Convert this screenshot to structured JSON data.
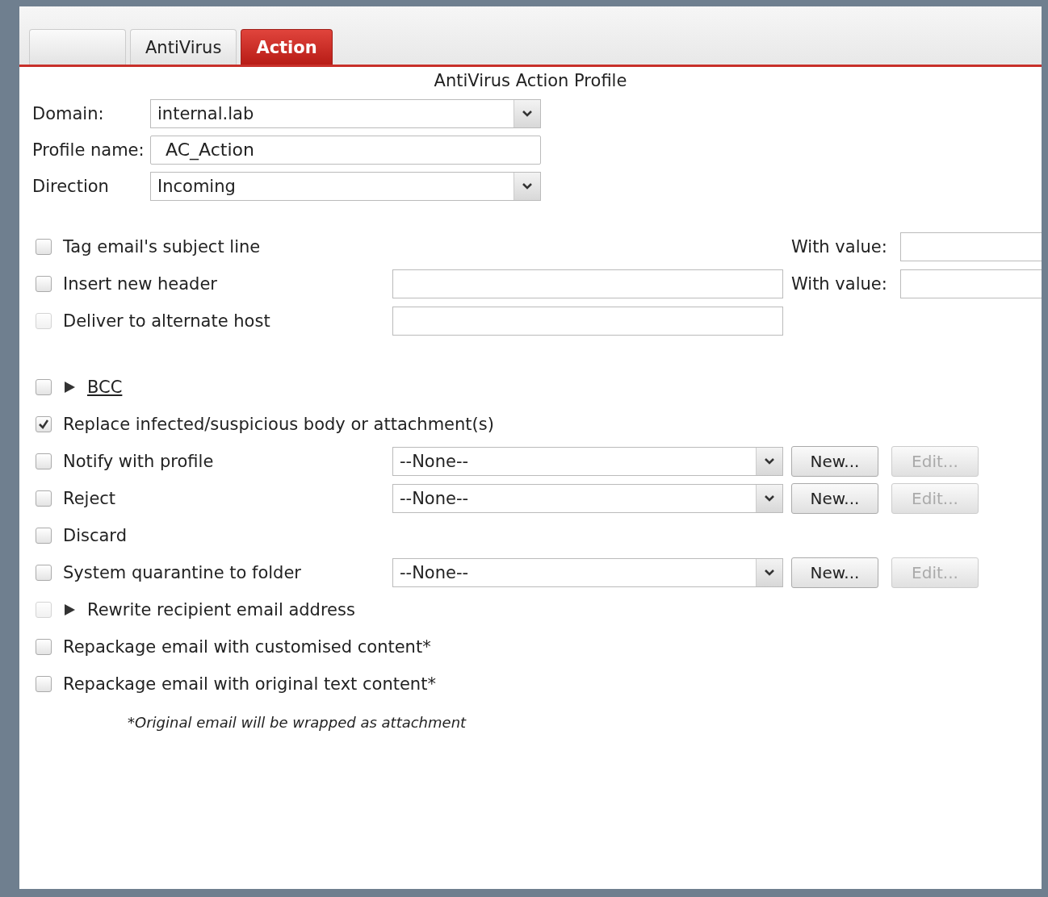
{
  "tabs": [
    {
      "selected": false
    },
    {
      "label": "AntiVirus",
      "selected": false
    },
    {
      "label": "Action",
      "selected": true
    }
  ],
  "title": "AntiVirus Action Profile",
  "fields": [
    {
      "kind": "select",
      "label": "Domain:",
      "value": "internal.lab"
    },
    {
      "kind": "text",
      "label": "Profile name:",
      "value": "AC_Action"
    },
    {
      "kind": "select",
      "label": "Direction",
      "value": "Incoming"
    }
  ],
  "options": [
    {
      "kind": "check",
      "label": "Tag email's subject line",
      "checked": false,
      "disabled": false,
      "with_value": "With value:"
    },
    {
      "kind": "check",
      "label": "Insert new header",
      "checked": false,
      "disabled": false,
      "field": {
        "kind": "text"
      },
      "with_value": "With value:"
    },
    {
      "kind": "check",
      "label": "Deliver to alternate host",
      "checked": false,
      "disabled": true,
      "field": {
        "kind": "text"
      }
    },
    {
      "kind": "link_expander",
      "label": "BCC",
      "checked": false,
      "disabled": false,
      "expanded": false
    },
    {
      "kind": "check",
      "label": "Replace infected/suspicious body or attachment(s)",
      "checked": true,
      "disabled": false
    },
    {
      "kind": "check",
      "label": "Notify with profile",
      "checked": false,
      "disabled": false,
      "field": {
        "kind": "select",
        "value": "--None--"
      },
      "buttons": [
        {
          "label": "New...",
          "disabled": false
        },
        {
          "label": "Edit...",
          "disabled": true
        }
      ]
    },
    {
      "kind": "check",
      "label": "Reject",
      "checked": false,
      "disabled": false,
      "field": {
        "kind": "select",
        "value": "--None--"
      },
      "buttons": [
        {
          "label": "New...",
          "disabled": false
        },
        {
          "label": "Edit...",
          "disabled": true
        }
      ]
    },
    {
      "kind": "check",
      "label": "Discard",
      "checked": false,
      "disabled": false
    },
    {
      "kind": "check",
      "label": "System quarantine to folder",
      "checked": false,
      "disabled": false,
      "field": {
        "kind": "select",
        "value": "--None--"
      },
      "buttons": [
        {
          "label": "New...",
          "disabled": false
        },
        {
          "label": "Edit...",
          "disabled": true
        }
      ]
    },
    {
      "kind": "expander",
      "label": "Rewrite recipient email address",
      "checked": false,
      "disabled": true,
      "expanded": false
    },
    {
      "kind": "check",
      "label": "Repackage email with customised content*",
      "checked": false,
      "disabled": false
    },
    {
      "kind": "check",
      "label": "Repackage email with original text content*",
      "checked": false,
      "disabled": false
    }
  ],
  "footnote": "*Original email will be wrapped as attachment"
}
